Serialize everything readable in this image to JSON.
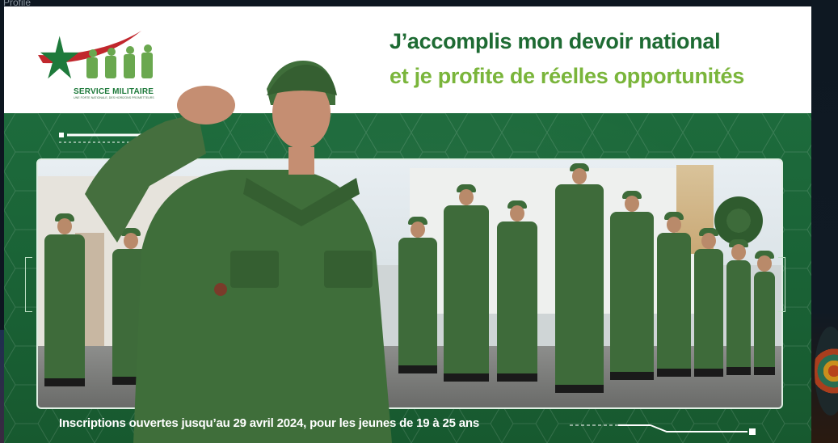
{
  "page": {
    "profile_label": "Profile"
  },
  "logo": {
    "title": "SERVICE MILITAIRE",
    "subtitle": "UNE FORTE NATIONALE, DES HORIZONS PROMETTEURS"
  },
  "headline": {
    "line1": "J’accomplis mon devoir national",
    "line2": "et je profite de réelles opportunités"
  },
  "footer": {
    "text": "Inscriptions ouvertes jusqu’au 29 avril 2024, pour les jeunes de 19 à 25 ans"
  },
  "colors": {
    "dark_green": "#1e6b33",
    "light_green": "#7ab53b",
    "flag_red": "#c1272d",
    "panel_green": "#1b6a3a"
  }
}
